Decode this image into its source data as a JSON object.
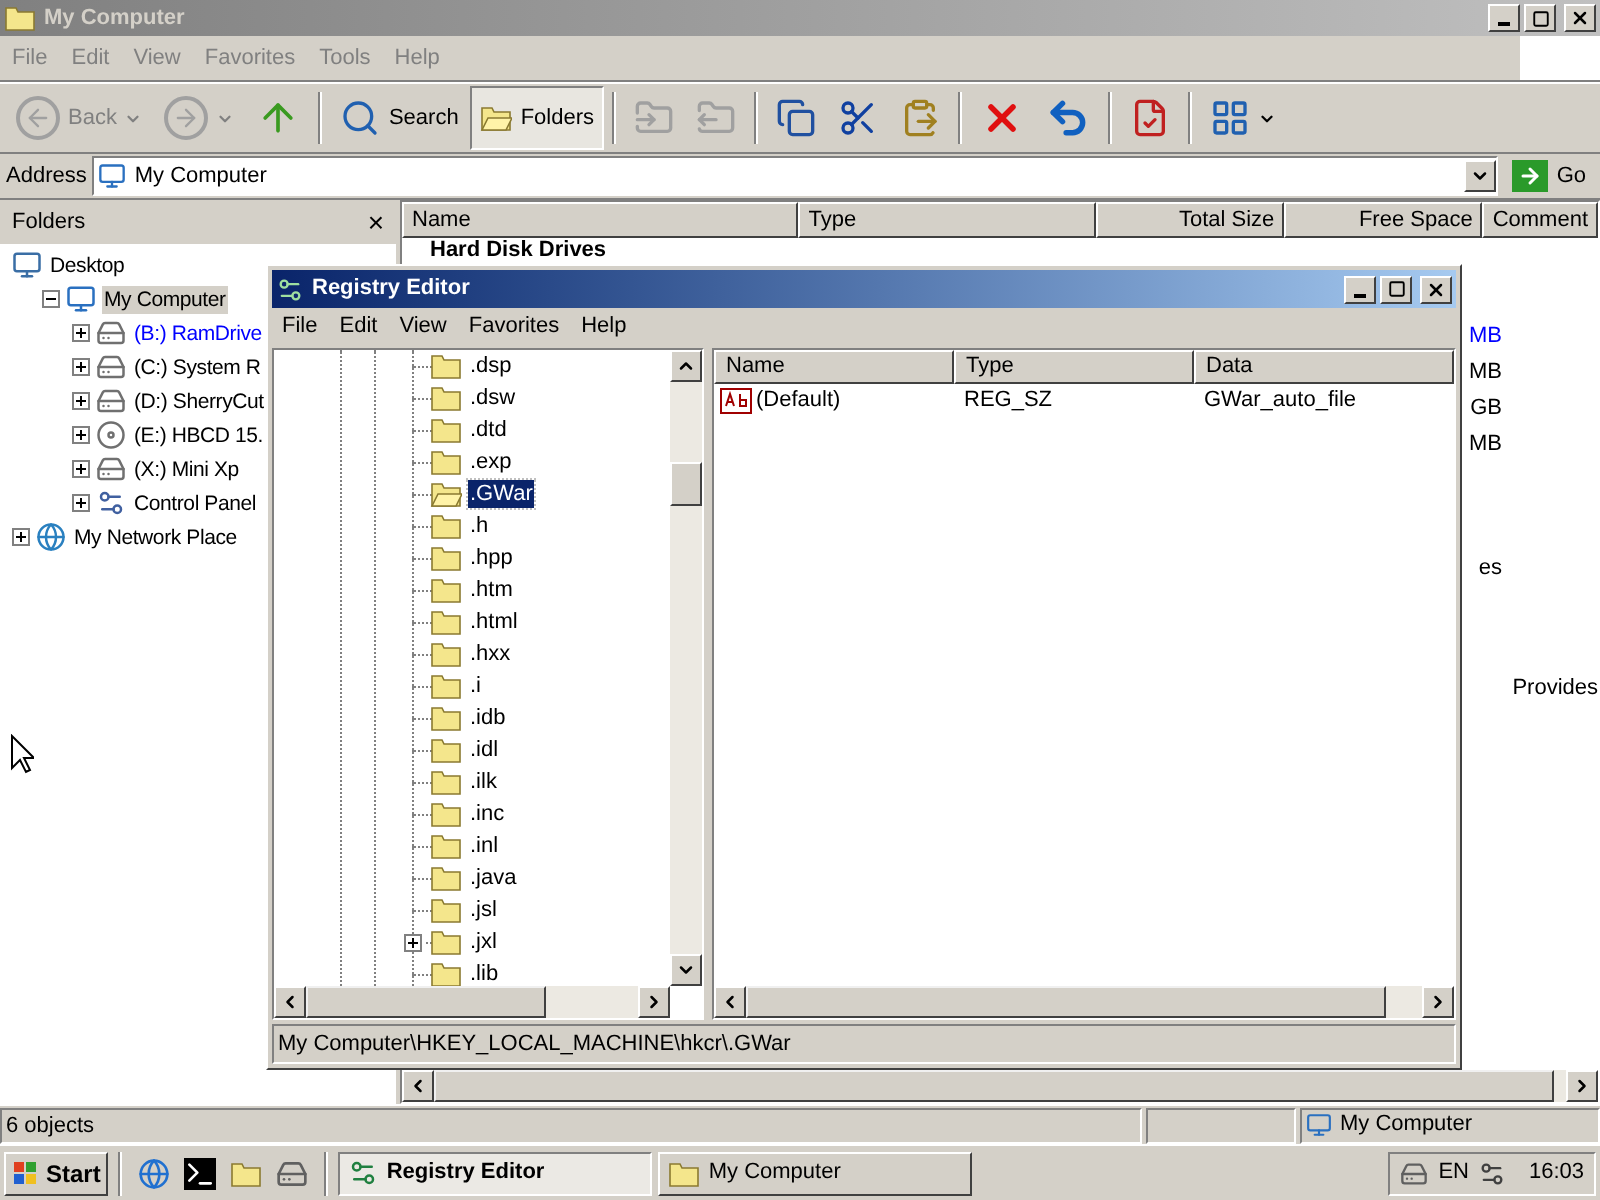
{
  "explorer": {
    "title": "My Computer",
    "menu": [
      "File",
      "Edit",
      "View",
      "Favorites",
      "Tools",
      "Help"
    ],
    "toolbar": [
      {
        "kind": "back",
        "label": "Back",
        "disabled": true,
        "pressed": false
      },
      {
        "kind": "forward",
        "disabled": true,
        "pressed": false
      },
      {
        "kind": "up",
        "disabled": false,
        "pressed": false
      },
      {
        "kind": "search",
        "label": "Search",
        "disabled": false,
        "pressed": false
      },
      {
        "kind": "folders",
        "label": "Folders",
        "disabled": false,
        "pressed": true
      },
      {
        "kind": "move",
        "disabled": true,
        "pressed": false
      },
      {
        "kind": "copy_to",
        "disabled": true,
        "pressed": false
      },
      {
        "kind": "copy",
        "disabled": false,
        "pressed": false
      },
      {
        "kind": "cut",
        "disabled": false,
        "pressed": false
      },
      {
        "kind": "paste",
        "disabled": false,
        "pressed": false
      },
      {
        "kind": "delete",
        "disabled": false,
        "pressed": false
      },
      {
        "kind": "undo",
        "disabled": false,
        "pressed": false
      },
      {
        "kind": "properties",
        "disabled": false,
        "pressed": false
      },
      {
        "kind": "views",
        "disabled": false,
        "pressed": false
      }
    ],
    "address": {
      "label": "Address",
      "value": "My Computer",
      "go": "Go"
    },
    "folders_pane": {
      "title": "Folders",
      "close": "×",
      "tree": [
        {
          "label": "Desktop",
          "kind": "desktop",
          "selected": false,
          "children": [
            {
              "label": "My Computer",
              "kind": "computer",
              "expanded": true,
              "selected": true,
              "children": [
                {
                  "label": "(B:) RamDrive",
                  "kind": "drive",
                  "expanded": false,
                  "selected": false,
                  "color": "#0000ff"
                },
                {
                  "label": "(C:) System R",
                  "kind": "drive",
                  "expanded": false,
                  "selected": false,
                  "color": "#000000"
                },
                {
                  "label": "(D:) SherryCut",
                  "kind": "drive",
                  "expanded": false,
                  "selected": false,
                  "color": "#000000"
                },
                {
                  "label": "(E:) HBCD 15.",
                  "kind": "cdrom",
                  "expanded": false,
                  "selected": false,
                  "color": "#000000"
                },
                {
                  "label": "(X:) Mini Xp",
                  "kind": "drive",
                  "expanded": false,
                  "selected": false,
                  "color": "#000000"
                },
                {
                  "label": "Control Panel",
                  "kind": "control_panel",
                  "expanded": false,
                  "selected": false,
                  "color": "#000000"
                }
              ]
            }
          ]
        },
        {
          "label": "My Network Place",
          "kind": "network",
          "expanded": false,
          "selected": false
        }
      ]
    },
    "list": {
      "columns": [
        "Name",
        "Type",
        "Total Size",
        "Free Space",
        "Comment"
      ],
      "group": "Hard Disk Drives",
      "rows": [
        {
          "kind": "drive",
          "free_space": "MB",
          "color": "#0000ff"
        },
        {
          "kind": "drive",
          "free_space": "MB",
          "color": "#000000"
        },
        {
          "kind": "drive",
          "free_space": "GB",
          "color": "#000000"
        },
        {
          "kind": "drive",
          "free_space": "MB",
          "color": "#000000"
        },
        {
          "kind": "removable",
          "free_space": "es",
          "color": "#000000"
        },
        {
          "kind": "other",
          "comment": "Provides",
          "color": "#000000"
        }
      ]
    },
    "status_bar": [
      "6 objects",
      "My Computer"
    ]
  },
  "registry_editor": {
    "title": "Registry Editor",
    "menu": [
      "File",
      "Edit",
      "View",
      "Favorites",
      "Help"
    ],
    "tree": [
      {
        "label": ".dsp",
        "selected": false,
        "expandable": false
      },
      {
        "label": ".dsw",
        "selected": false,
        "expandable": false
      },
      {
        "label": ".dtd",
        "selected": false,
        "expandable": false
      },
      {
        "label": ".exp",
        "selected": false,
        "expandable": false
      },
      {
        "label": ".GWar",
        "selected": true,
        "expandable": false
      },
      {
        "label": ".h",
        "selected": false,
        "expandable": false
      },
      {
        "label": ".hpp",
        "selected": false,
        "expandable": false
      },
      {
        "label": ".htm",
        "selected": false,
        "expandable": false
      },
      {
        "label": ".html",
        "selected": false,
        "expandable": false
      },
      {
        "label": ".hxx",
        "selected": false,
        "expandable": false
      },
      {
        "label": ".i",
        "selected": false,
        "expandable": false
      },
      {
        "label": ".idb",
        "selected": false,
        "expandable": false
      },
      {
        "label": ".idl",
        "selected": false,
        "expandable": false
      },
      {
        "label": ".ilk",
        "selected": false,
        "expandable": false
      },
      {
        "label": ".inc",
        "selected": false,
        "expandable": false
      },
      {
        "label": ".inl",
        "selected": false,
        "expandable": false
      },
      {
        "label": ".java",
        "selected": false,
        "expandable": false
      },
      {
        "label": ".jsl",
        "selected": false,
        "expandable": false
      },
      {
        "label": ".jxl",
        "selected": false,
        "expandable": true
      },
      {
        "label": ".lib",
        "selected": false,
        "expandable": false
      }
    ],
    "columns": [
      "Name",
      "Type",
      "Data"
    ],
    "values": [
      {
        "kind": "string",
        "name": "(Default)",
        "type": "REG_SZ",
        "data": "GWar_auto_file"
      }
    ],
    "status_bar": "My Computer\\HKEY_LOCAL_MACHINE\\hkcr\\.GWar"
  },
  "taskbar": {
    "start": "Start",
    "quick_launch": [
      {
        "kind": "browser"
      },
      {
        "kind": "console"
      },
      {
        "kind": "folder"
      },
      {
        "kind": "drive"
      }
    ],
    "tasks": [
      {
        "kind": "registry",
        "label": "Registry Editor",
        "selected": true
      },
      {
        "kind": "folder",
        "label": "My Computer",
        "selected": false
      }
    ],
    "language": "EN",
    "time": "16:03"
  }
}
